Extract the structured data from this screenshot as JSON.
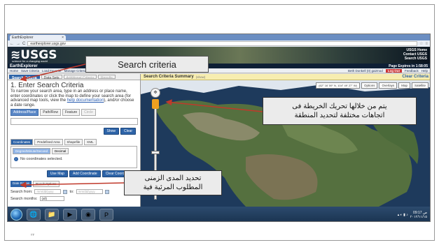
{
  "browser": {
    "tab_title": "EarthExplorer",
    "url": "earthexplorer.usgs.gov"
  },
  "usgs": {
    "logo": "≋USGS",
    "tagline": "science for a changing world",
    "links": [
      "USGS Home",
      "Contact USGS",
      "Search USGS"
    ]
  },
  "app": {
    "title": "EarthExplorer",
    "expires": "Page Expires in 1:58:05",
    "nav": [
      "Home",
      "Save Criteria",
      "Load Favorite",
      "Manage Criteria"
    ],
    "user": "Beth Donkell (0)   ga2mod",
    "login": "Log Out",
    "feedback": "Feedback",
    "help": "Help"
  },
  "panel": {
    "tabs": [
      "Search Criteria",
      "Data Sets",
      "Additional Criteria",
      "Results"
    ],
    "heading": "1. Enter Search Criteria",
    "instructions_before": "To narrow your search area, type in an address or place name, enter coordinates or click the map to define your search area (for advanced map tools, view the ",
    "instructions_link": "help documentation",
    "instructions_after": "), and/or choose a date range.",
    "subtabs": [
      "Address/Place",
      "Path/Row",
      "Feature",
      "Circle"
    ],
    "show_btn": "Show",
    "clear_btn": "Clear",
    "coord_tabs": [
      "Coordinates",
      "Predefined Area",
      "Shapefile",
      "KML"
    ],
    "coord_modes": [
      "Degree/Minute/Second",
      "Decimal"
    ],
    "no_coords": "No coordinates selected.",
    "use_map": "Use Map",
    "add_coordinate": "Add Coordinate",
    "clear_coordinates": "Clear Coordinates",
    "date_tabs": [
      "Date Range",
      "Result Options"
    ],
    "search_from_label": "Search from:",
    "date_placeholder": "mm/dd/yyyy",
    "to_label": "to:",
    "search_months_label": "Search months:",
    "months_value": "(all)"
  },
  "map": {
    "summary_title": "Search Criteria Summary",
    "summary_show": "(show)",
    "clear_criteria": "Clear Criteria",
    "coords": "(62° 16' 59\" N, 104° 49' 27\" W)",
    "tools": [
      "Options",
      "Overlays",
      "Map",
      "Satellite"
    ]
  },
  "taskbar": {
    "time": "09:17 ص",
    "date": "٢٠١٢/١١/١٥"
  },
  "callouts": {
    "search": "Search criteria",
    "map_line1": "يتم من خلالها تحريك الخريطة فى",
    "map_line2": "اتجاهات مختلفة لتحديد المنطقة",
    "date_line1": "تحديد المدى الزمنى",
    "date_line2": "المطلوب المرئية فية"
  },
  "page_number": "٢٢"
}
